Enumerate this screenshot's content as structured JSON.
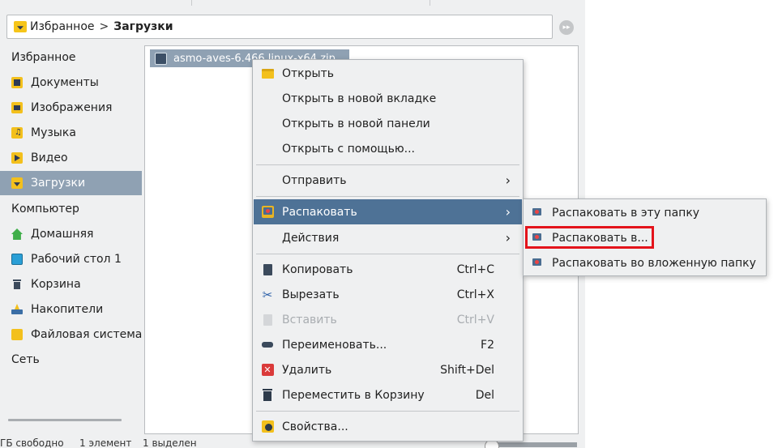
{
  "location": {
    "breadcrumb": [
      "Избранное",
      "Загрузки"
    ],
    "separator": ">"
  },
  "sidebar": {
    "favorites_header": "Избранное",
    "favorites": [
      {
        "label": "Документы",
        "icon": "documents-folder-icon",
        "color": "#f3c01d"
      },
      {
        "label": "Изображения",
        "icon": "pictures-folder-icon",
        "color": "#f3c01d"
      },
      {
        "label": "Музыка",
        "icon": "music-folder-icon",
        "color": "#f3c01d"
      },
      {
        "label": "Видео",
        "icon": "video-folder-icon",
        "color": "#f3c01d"
      },
      {
        "label": "Загрузки",
        "icon": "downloads-folder-icon",
        "color": "#f3c01d",
        "selected": true
      }
    ],
    "computer_header": "Компьютер",
    "computer": [
      {
        "label": "Домашняя",
        "icon": "home-icon"
      },
      {
        "label": "Рабочий стол 1",
        "icon": "desktop-icon"
      },
      {
        "label": "Корзина",
        "icon": "trash-icon"
      },
      {
        "label": "Накопители",
        "icon": "drives-icon"
      },
      {
        "label": "Файловая система",
        "icon": "filesystem-folder-icon"
      }
    ],
    "network_header": "Сеть"
  },
  "file": {
    "name": "asmo-aves-6.466.linux-x64.zip"
  },
  "status": {
    "free": "ГБ свободно",
    "count": "1 элемент",
    "selected": "1 выделен"
  },
  "menu": {
    "items": [
      {
        "label": "Открыть",
        "icon": "folder-open-icon"
      },
      {
        "label": "Открыть в новой вкладке"
      },
      {
        "label": "Открыть в новой панели"
      },
      {
        "label": "Открыть с помощью..."
      },
      {
        "label": "Отправить",
        "submenu": true
      },
      {
        "label": "Распаковать",
        "icon": "archive-icon",
        "submenu": true,
        "active": true
      },
      {
        "label": "Действия",
        "submenu": true
      },
      {
        "label": "Копировать",
        "icon": "copy-icon",
        "shortcut": "Ctrl+C"
      },
      {
        "label": "Вырезать",
        "icon": "scissors-icon",
        "shortcut": "Ctrl+X"
      },
      {
        "label": "Вставить",
        "icon": "paste-icon",
        "shortcut": "Ctrl+V",
        "disabled": true
      },
      {
        "label": "Переименовать...",
        "icon": "rename-icon",
        "shortcut": "F2"
      },
      {
        "label": "Удалить",
        "icon": "delete-icon",
        "shortcut": "Shift+Del"
      },
      {
        "label": "Переместить в Корзину",
        "icon": "trash-icon",
        "shortcut": "Del"
      },
      {
        "label": "Свойства...",
        "icon": "properties-icon"
      }
    ],
    "arrow": "›"
  },
  "submenu": {
    "items": [
      {
        "label": "Распаковать в эту папку"
      },
      {
        "label": "Распаковать в...",
        "highlighted": true
      },
      {
        "label": "Распаковать во вложенную папку"
      }
    ]
  },
  "colors": {
    "selection": "#8fa1b3",
    "menu_active": "#4e7296",
    "highlight": "#e4131b"
  }
}
